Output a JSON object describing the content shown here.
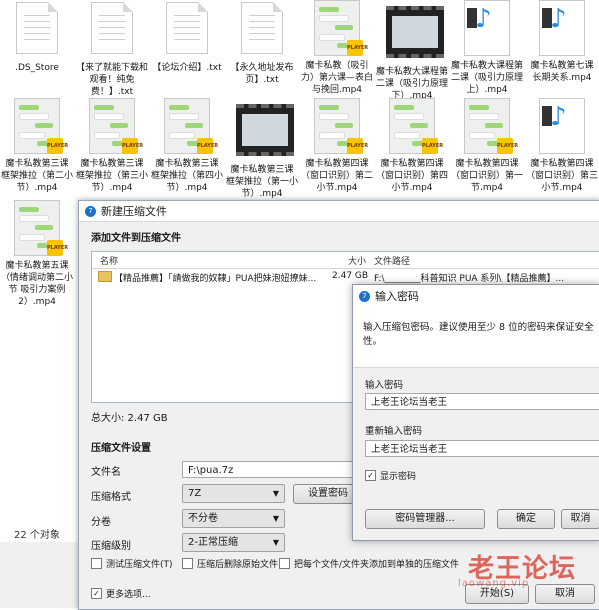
{
  "explorer": {
    "files": [
      {
        "name": ".DS_Store",
        "kind": "doc"
      },
      {
        "name": "【来了就能下载和观看！纯免费！】.txt",
        "kind": "doc"
      },
      {
        "name": "【论坛介绍】.txt",
        "kind": "doc"
      },
      {
        "name": "【永久地址发布页】.txt",
        "kind": "doc"
      },
      {
        "name": "魔卡私教（吸引力）第六课—表白与挽回.mp4",
        "kind": "chat"
      },
      {
        "name": "魔卡私教大课程第二课（吸引力原理下）.mp4",
        "kind": "film"
      },
      {
        "name": "魔卡私教大课程第二课（吸引力原理上）.mp4",
        "kind": "music"
      },
      {
        "name": "魔卡私教第七课 长期关系.mp4",
        "kind": "music"
      },
      {
        "name": "魔卡私教第三课 框架推拉（第二小节）.mp4",
        "kind": "chat"
      },
      {
        "name": "魔卡私教第三课 框架推拉（第三小节）.mp4",
        "kind": "chat"
      },
      {
        "name": "魔卡私教第三课 框架推拉（第四小节）.mp4",
        "kind": "chat"
      },
      {
        "name": "魔卡私教第三课 框架推拉（第一小节）.mp4",
        "kind": "film"
      },
      {
        "name": "魔卡私教第四课（窗口识别）第二小节.mp4",
        "kind": "chat"
      },
      {
        "name": "魔卡私教第四课（窗口识别）第四小节.mp4",
        "kind": "chat"
      },
      {
        "name": "魔卡私教第四课（窗口识别）第一节.mp4",
        "kind": "chat"
      },
      {
        "name": "魔卡私教第四课（窗口识别）第三小节.mp4",
        "kind": "music"
      },
      {
        "name": "魔卡私教第五课（情绪调动第二小节 吸引力案例2）.mp4",
        "kind": "chat"
      }
    ],
    "object_count": "22 个对象"
  },
  "archive": {
    "title": "新建压缩文件",
    "add_section": "添加文件到压缩文件",
    "columns": {
      "name": "名称",
      "size": "大小",
      "path": "文件路径"
    },
    "rows": [
      {
        "name": "【精品推薦】「請做我的奴隸」PUA把妹泡妞撩妹...",
        "size": "2.47 GB",
        "path": "F:\\________科普知识 PUA 系列\\【精品推薦】..."
      }
    ],
    "total": "总大小: 2.47 GB",
    "settings_section": "压缩文件设置",
    "filename_label": "文件名",
    "filename_value": "F:\\pua.7z",
    "format_label": "压缩格式",
    "format_value": "7Z",
    "split_label": "分卷",
    "split_value": "不分卷",
    "level_label": "压缩级别",
    "level_value": "2-正常压缩",
    "set_password": "设置密码",
    "test_label": "测试压缩文件(T)",
    "delete_label": "压缩后删除原始文件",
    "separate_label": "把每个文件/文件夹添加到单独的压缩文件",
    "more_label": "更多选项...",
    "start_button": "开始(S)",
    "cancel_button": "取消"
  },
  "password": {
    "title": "输入密码",
    "hint": "输入压缩包密码。建议使用至少 8 位的密码来保证安全性。",
    "enter_label": "输入密码",
    "enter_value": "上老王论坛当老王",
    "reenter_label": "重新输入密码",
    "reenter_value": "上老王论坛当老王",
    "show_label": "显示密码",
    "manager_button": "密码管理器...",
    "ok_button": "确定",
    "cancel_button": "取消"
  },
  "watermark": {
    "text": "老王论坛",
    "sub": "laowang.vip"
  }
}
